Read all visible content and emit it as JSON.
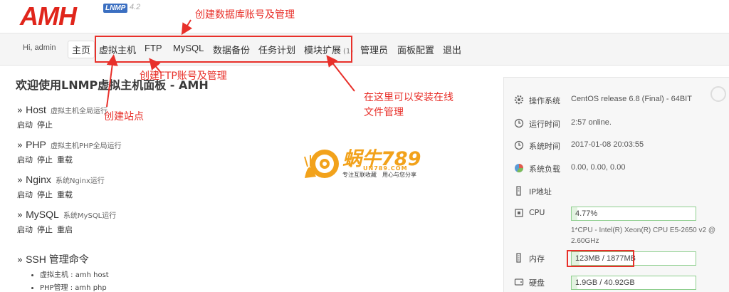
{
  "header": {
    "logo": "AMH",
    "logo_sub": "LNMP",
    "version": "4.2"
  },
  "nav": {
    "greeting": "Hi, admin",
    "items": [
      "主页",
      "虚拟主机",
      "FTP",
      "MySQL",
      "数据备份",
      "任务计划",
      "模块扩展",
      "管理员",
      "面板配置",
      "退出"
    ],
    "module_count": "(1)"
  },
  "main": {
    "title": "欢迎使用LNMP虚拟主机面板 - AMH",
    "services": [
      {
        "name": "Host",
        "desc": "虚拟主机全局运行",
        "actions": [
          "启动",
          "停止"
        ]
      },
      {
        "name": "PHP",
        "desc": "虚拟主机PHP全局运行",
        "actions": [
          "启动",
          "停止",
          "重载"
        ]
      },
      {
        "name": "Nginx",
        "desc": "系统Nginx运行",
        "actions": [
          "启动",
          "停止",
          "重载"
        ]
      },
      {
        "name": "MySQL",
        "desc": "系统MySQL运行",
        "actions": [
          "启动",
          "停止",
          "重启"
        ]
      }
    ],
    "ssh": {
      "title": "SSH 管理命令",
      "items": [
        "虚拟主机 : amh host",
        "PHP管理 : amh php"
      ]
    }
  },
  "panel": {
    "os_label": "操作系统",
    "os_value": "CentOS release 6.8 (Final) - 64BIT",
    "uptime_label": "运行时间",
    "uptime_value": "2:57 online.",
    "systime_label": "系统时间",
    "systime_value": "2017-01-08 20:03:55",
    "load_label": "系统负载",
    "load_value": "0.00, 0.00, 0.00",
    "ip_label": "IP地址",
    "cpu_label": "CPU",
    "cpu_value": "4.77%",
    "cpu_fraction": 0.0477,
    "cpu_detail": "1*CPU - Intel(R) Xeon(R) CPU E5-2650 v2 @ 2.60GHz",
    "mem_label": "内存",
    "mem_value": "123MB / 1877MB",
    "mem_fraction": 0.0655,
    "disk_label": "硬盘",
    "disk_value": "1.9GB / 40.92GB",
    "disk_fraction": 0.0464
  },
  "annotations": {
    "db": "创建数据库账号及管理",
    "ftp": "创建FTP账号及管理",
    "site": "创建站点",
    "module_line1": "在这里可以安装在线",
    "module_line2": "文件管理"
  },
  "watermark": {
    "title": "蜗牛789",
    "site": "UN789.COM",
    "slogan": "专注互联收藏　用心与您分享"
  },
  "colors": {
    "accent_red": "#e8302a",
    "bar_border": "#8fcf8f",
    "logo_red": "#e0251b"
  }
}
